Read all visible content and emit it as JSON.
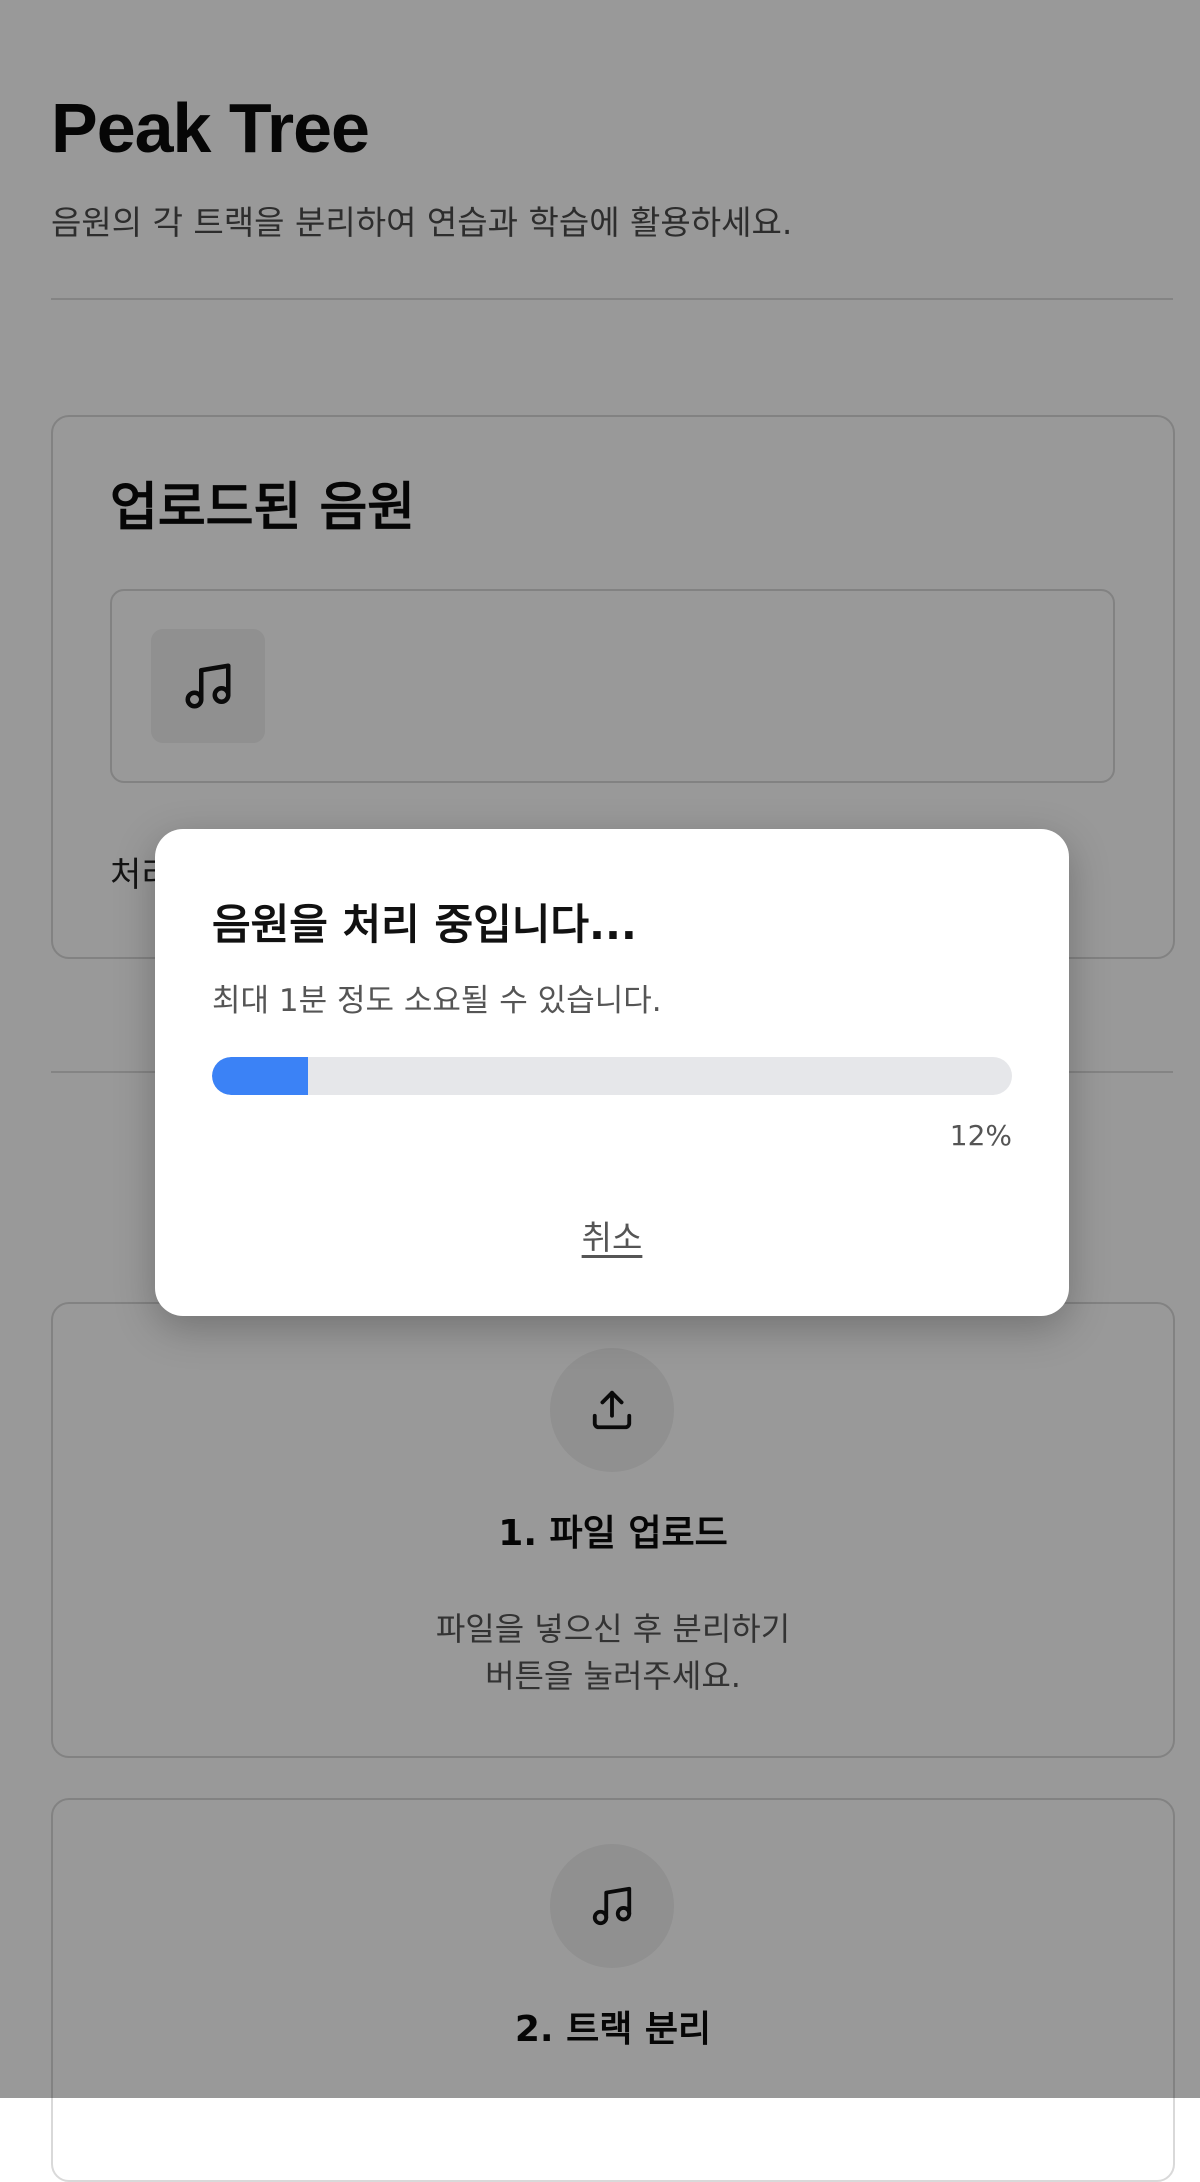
{
  "header": {
    "title": "Peak Tree",
    "subtitle": "음원의 각 트랙을 분리하여 연습과 학습에 활용하세요."
  },
  "uploaded_section": {
    "title": "업로드된 음원",
    "file_icon": "music-note-icon",
    "status_text_partial": "처리"
  },
  "steps": [
    {
      "icon": "upload-icon",
      "title": "1. 파일 업로드",
      "description_lines": [
        "파일을 넣으신 후 분리하기",
        "버튼을 눌러주세요."
      ]
    },
    {
      "icon": "music-note-icon",
      "title": "2. 트랙 분리"
    }
  ],
  "modal": {
    "title": "음원을 처리 중입니다...",
    "subtitle": "최대 1분 정도 소요될 수 있습니다.",
    "progress_fraction": 0.12,
    "progress_label": "12%",
    "cancel_label": "취소"
  },
  "colors": {
    "accent": "#3b82f6",
    "progress_track": "#e6e7ea",
    "overlay": "rgba(0,0,0,0.40)"
  }
}
